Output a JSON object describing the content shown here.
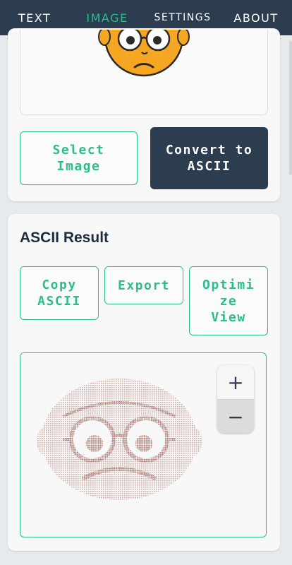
{
  "nav": {
    "tabs": [
      {
        "label": "TEXT",
        "active": false
      },
      {
        "label": "IMAGE",
        "active": true
      },
      {
        "label": "SETTINGS",
        "active": false
      },
      {
        "label": "ABOUT",
        "active": false
      }
    ]
  },
  "image_card": {
    "select_label": "Select\nImage",
    "convert_label": "Convert to\nASCII"
  },
  "result_card": {
    "title": "ASCII Result",
    "copy_label": "Copy\nASCII",
    "export_label": "Export",
    "optimize_label": "Optimi\nze\nView",
    "zoom_in": "+",
    "zoom_out": "−"
  },
  "colors": {
    "nav_bg": "#2b3d4f",
    "accent": "#2bbd8e",
    "dark_button": "#2b3d4f",
    "ascii_ink": "#c9a29c"
  },
  "icons": [
    "sad-face-emoji-icon",
    "ascii-art-face-icon",
    "plus-icon",
    "minus-icon"
  ]
}
